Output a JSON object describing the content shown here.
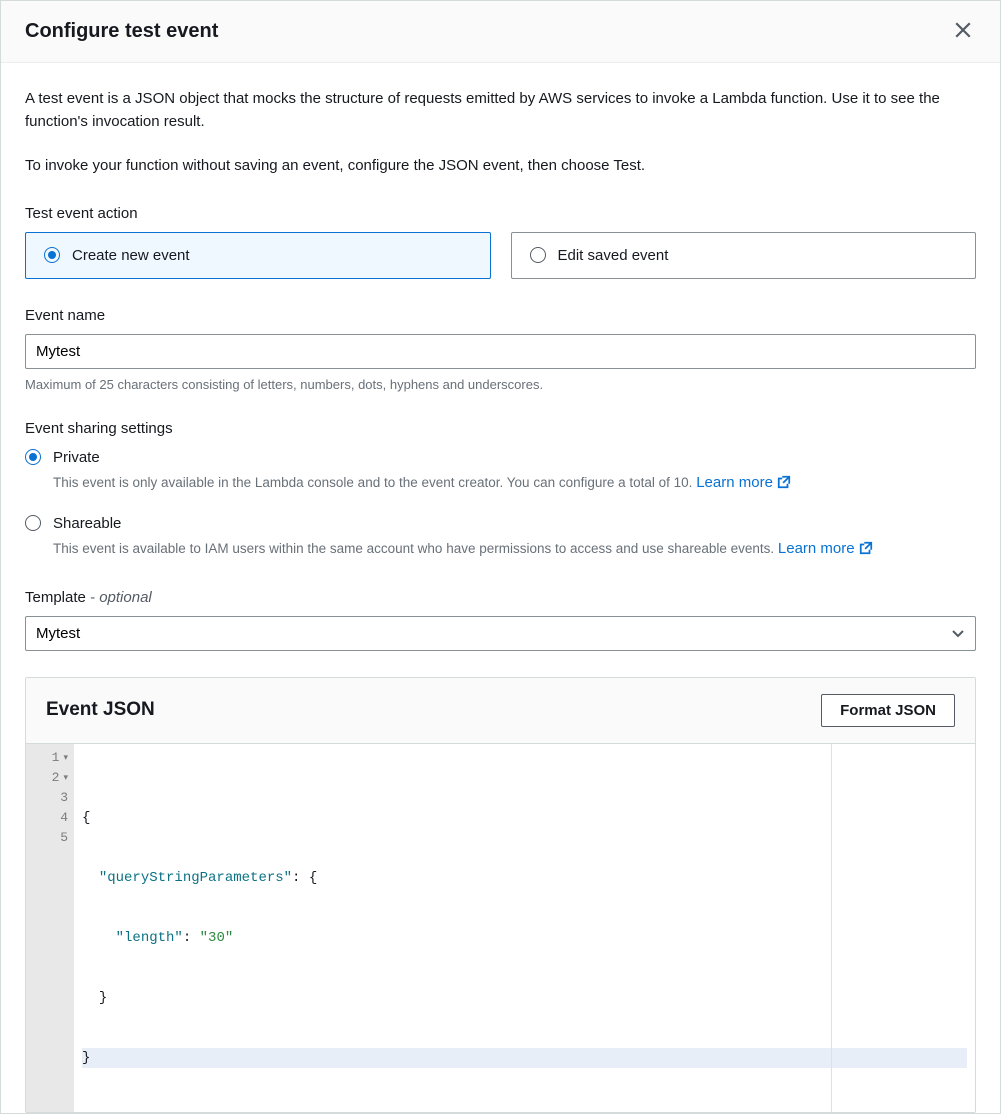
{
  "header": {
    "title": "Configure test event"
  },
  "intro": {
    "p1": "A test event is a JSON object that mocks the structure of requests emitted by AWS services to invoke a Lambda function. Use it to see the function's invocation result.",
    "p2": "To invoke your function without saving an event, configure the JSON event, then choose Test."
  },
  "test_event_action": {
    "label": "Test event action",
    "option_create": "Create new event",
    "option_edit": "Edit saved event",
    "selected": "create"
  },
  "event_name": {
    "label": "Event name",
    "value": "Mytest",
    "helper": "Maximum of 25 characters consisting of letters, numbers, dots, hyphens and underscores."
  },
  "sharing": {
    "label": "Event sharing settings",
    "selected": "private",
    "private": {
      "title": "Private",
      "desc": "This event is only available in the Lambda console and to the event creator. You can configure a total of 10.",
      "learn_more": "Learn more"
    },
    "shareable": {
      "title": "Shareable",
      "desc": "This event is available to IAM users within the same account who have permissions to access and use shareable events.",
      "learn_more": "Learn more"
    }
  },
  "template": {
    "label": "Template",
    "optional": "- optional",
    "value": "Mytest"
  },
  "json_panel": {
    "title": "Event JSON",
    "format_button": "Format JSON",
    "gutter": [
      "1",
      "2",
      "3",
      "4",
      "5"
    ],
    "code": {
      "k1": "\"queryStringParameters\"",
      "k2": "\"length\"",
      "v2": "\"30\""
    }
  }
}
